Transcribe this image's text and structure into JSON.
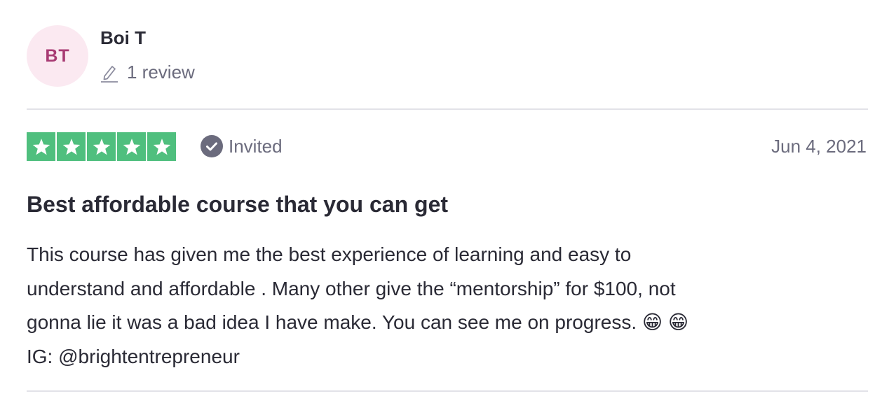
{
  "consumer": {
    "initials": "BT",
    "name": "Boi T",
    "review_count_label": "1 review"
  },
  "review": {
    "rating": 5,
    "rating_max": 5,
    "star_color": "#4fbf7e",
    "verification_label": "Invited",
    "date": "Jun 4, 2021",
    "title": "Best affordable course that you can get",
    "body": "This course has given me the best experience of learning and easy to\nunderstand and affordable . Many other give the “mentorship” for $100, not\ngonna lie it was a bad idea I have make. You can see me on progress. 😁 😁\nIG: @brightentrepreneur"
  },
  "icons": {
    "review_count": "pencil-icon",
    "verification": "checkmark-circle-icon",
    "rating": "star-icon"
  }
}
